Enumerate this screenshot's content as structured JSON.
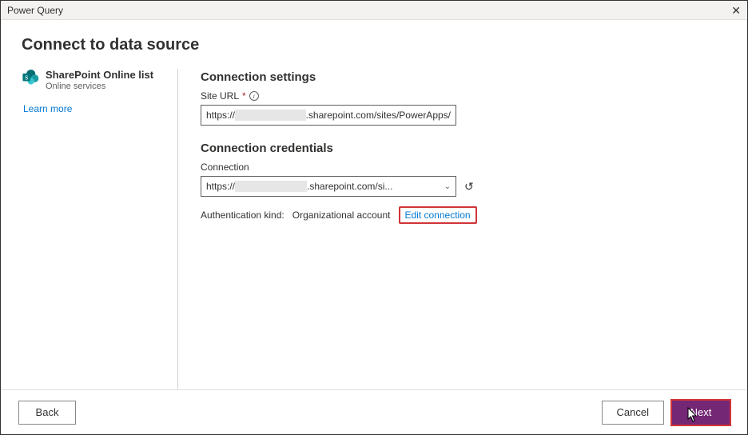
{
  "window": {
    "title": "Power Query"
  },
  "page": {
    "title": "Connect to data source"
  },
  "source": {
    "name": "SharePoint Online list",
    "category": "Online services",
    "learn_more": "Learn more"
  },
  "settings": {
    "heading": "Connection settings",
    "site_url_label": "Site URL",
    "site_url_prefix": "https://",
    "site_url_suffix": ".sharepoint.com/sites/PowerApps/"
  },
  "credentials": {
    "heading": "Connection credentials",
    "connection_label": "Connection",
    "connection_prefix": "https://",
    "connection_suffix": ".sharepoint.com/si...",
    "auth_kind_label": "Authentication kind:",
    "auth_kind_value": "Organizational account",
    "edit_link": "Edit connection"
  },
  "footer": {
    "back": "Back",
    "cancel": "Cancel",
    "next": "Next"
  }
}
